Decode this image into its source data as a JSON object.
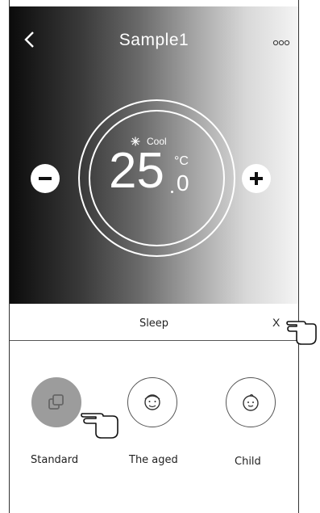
{
  "header": {
    "title": "Sample1",
    "back_icon": "chevron-left-icon",
    "more_icon": "more-dots-icon"
  },
  "thermostat": {
    "mode_icon": "snowflake-icon",
    "mode": "Cool",
    "temperature": "25",
    "unit": "°C",
    "decimal": "0",
    "decrease_icon": "minus-icon",
    "increase_icon": "plus-icon"
  },
  "sleep_panel": {
    "title": "Sleep",
    "close_label": "X",
    "options": [
      {
        "label": "Standard",
        "icon": "standard-mode-icon",
        "selected": true
      },
      {
        "label": "The aged",
        "icon": "elderly-face-icon",
        "selected": false
      },
      {
        "label": "Child",
        "icon": "child-face-icon",
        "selected": false
      }
    ]
  },
  "colors": {
    "selected_option": "#9c9c9c",
    "gradient_dark": "#0b0b0b",
    "gradient_light": "#f4f4f4"
  }
}
